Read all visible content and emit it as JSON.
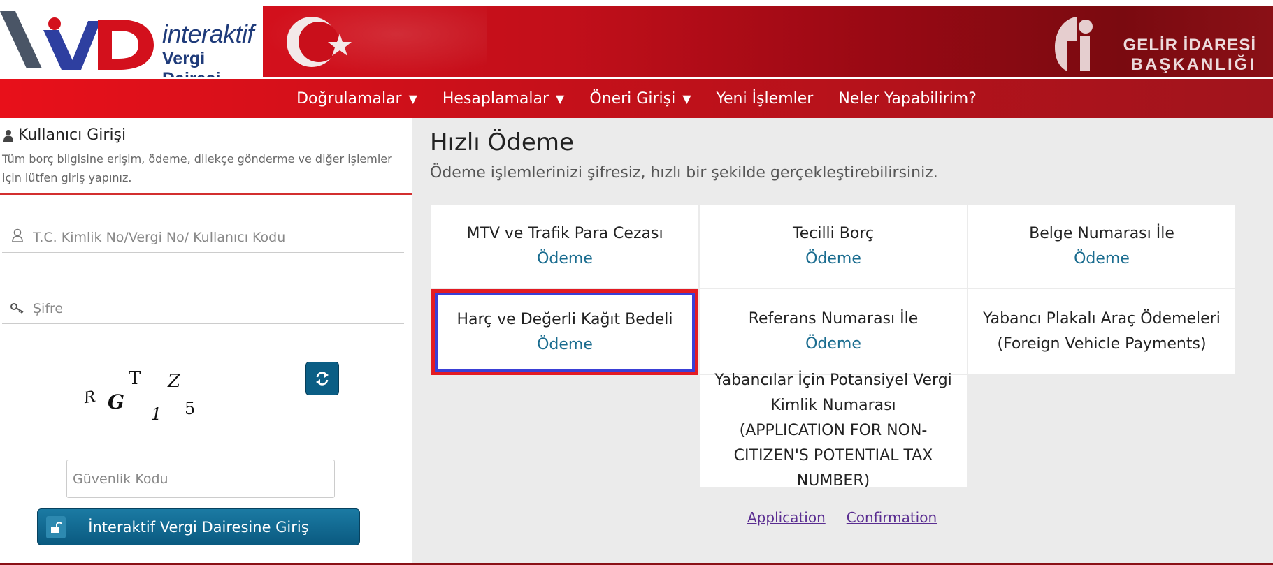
{
  "header": {
    "logo_line1": "interaktif",
    "logo_line2": "Vergi Dairesi",
    "gib_line1": "GELİR İDARESİ",
    "gib_line2": "BAŞKANLIĞI"
  },
  "nav": {
    "items": [
      {
        "label": "Doğrulamalar",
        "caret": "▼"
      },
      {
        "label": "Hesaplamalar",
        "caret": "▼"
      },
      {
        "label": "Öneri Girişi",
        "caret": "▼"
      },
      {
        "label": "Yeni İşlemler"
      },
      {
        "label": "Neler Yapabilirim?"
      }
    ]
  },
  "login": {
    "title": "Kullanıcı Girişi",
    "description": "Tüm borç bilgisine erişim, ödeme, dilekçe gönderme ve diğer işlemler için lütfen giriş yapınız.",
    "user_placeholder": "T.C. Kimlik No/Vergi No/ Kullanıcı Kodu",
    "password_placeholder": "Şifre",
    "captcha_chars": [
      "R",
      "G",
      "T",
      "1",
      "Z",
      "5"
    ],
    "security_placeholder": "Güvenlik Kodu",
    "submit_label": "İnteraktif Vergi Dairesine Giriş"
  },
  "quick_pay": {
    "title": "Hızlı Ödeme",
    "subtitle": "Ödeme işlemlerinizi şifresiz, hızlı bir şekilde gerçekleştirebilirsiniz.",
    "tiles": [
      {
        "title": "MTV ve Trafik Para Cezası",
        "action": "Ödeme"
      },
      {
        "title": "Tecilli Borç",
        "action": "Ödeme"
      },
      {
        "title": "Belge Numarası İle",
        "action": "Ödeme"
      },
      {
        "title": "Harç ve Değerli Kağıt Bedeli",
        "action": "Ödeme",
        "selected": true
      },
      {
        "title": "Referans Numarası İle",
        "action": "Ödeme"
      },
      {
        "title": "Yabancı Plakalı Araç Ödemeleri",
        "action": "(Foreign Vehicle Payments)"
      },
      {
        "title": "Yabancılar İçin Potansiyel Vergi Kimlik Numarası",
        "action": "(APPLICATION FOR NON-CITIZEN'S POTENTIAL TAX NUMBER)"
      }
    ],
    "links": {
      "application": "Application",
      "confirmation": "Confirmation"
    }
  },
  "colors": {
    "nav_red": "#e8101a",
    "banner_dark": "#7a0a10",
    "accent_blue": "#1a6c8f",
    "button_blue": "#0b5e85",
    "selection_red": "#e31b23",
    "selection_blue": "#3a3fd6",
    "link_purple": "#5a2d91"
  },
  "icons": {
    "user": "user-icon",
    "key": "key-icon",
    "refresh": "refresh-icon",
    "lock": "unlock-icon"
  }
}
